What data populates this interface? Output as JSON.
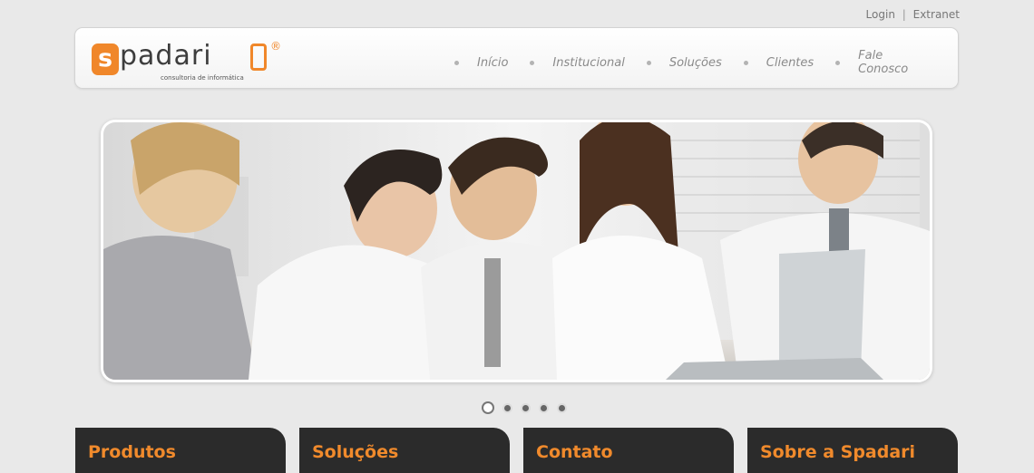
{
  "toplinks": {
    "login": "Login",
    "separator": "|",
    "extranet": "Extranet"
  },
  "logo": {
    "s": "s",
    "word": "padari",
    "reg": "®",
    "tagline": "consultoria de informática"
  },
  "nav": {
    "items": [
      {
        "label": "Início"
      },
      {
        "label": "Institucional"
      },
      {
        "label": "Soluções"
      },
      {
        "label": "Clientes"
      },
      {
        "label": "Fale Conosco"
      }
    ]
  },
  "slider": {
    "current": 1,
    "total": 5
  },
  "boxes": [
    {
      "title": "Produtos"
    },
    {
      "title": "Soluções"
    },
    {
      "title": "Contato"
    },
    {
      "title": "Sobre a Spadari"
    }
  ],
  "colors": {
    "accent": "#f0872a",
    "text": "#8a8a8a",
    "box": "#2b2b2b"
  }
}
